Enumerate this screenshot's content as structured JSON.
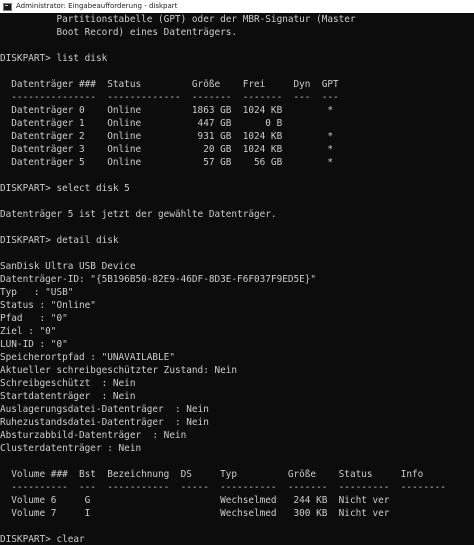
{
  "window": {
    "title": "Administrator: Eingabeaufforderung - diskpart"
  },
  "console": {
    "lines": [
      "          Partitionstabelle (GPT) oder der MBR-Signatur (Master",
      "          Boot Record) eines Datenträgers.",
      "",
      "DISKPART> list disk",
      "",
      "  Datenträger ###  Status         Größe    Frei     Dyn  GPT",
      "  ---------------  -------------  -------  -------  ---  ---",
      "  Datenträger 0    Online         1863 GB  1024 KB        *",
      "  Datenträger 1    Online          447 GB      0 B",
      "  Datenträger 2    Online          931 GB  1024 KB        *",
      "  Datenträger 3    Online           20 GB  1024 KB        *",
      "  Datenträger 5    Online           57 GB    56 GB        *",
      "",
      "DISKPART> select disk 5",
      "",
      "Datenträger 5 ist jetzt der gewählte Datenträger.",
      "",
      "DISKPART> detail disk",
      "",
      "SanDisk Ultra USB Device",
      "Datenträger-ID: \"{5B196B50-82E9-46DF-8D3E-F6F037F9ED5E}\"",
      "Typ   : \"USB\"",
      "Status : \"Online\"",
      "Pfad   : \"0\"",
      "Ziel : \"0\"",
      "LUN-ID : \"0\"",
      "Speicherortpfad : \"UNAVAILABLE\"",
      "Aktueller schreibgeschützter Zustand: Nein",
      "Schreibgeschützt  : Nein",
      "Startdatenträger  : Nein",
      "Auslagerungsdatei-Datenträger  : Nein",
      "Ruhezustandsdatei-Datenträger  : Nein",
      "Absturzabbild-Datenträger  : Nein",
      "Clusterdatenträger : Nein",
      "",
      "  Volume ###  Bst  Bezeichnung  DS     Typ         Größe    Status     Info",
      "  ----------  ---  -----------  -----  ----------  -------  ---------  --------",
      "  Volume 6     G                       Wechselmed   244 KB  Nicht ver",
      "  Volume 7     I                       Wechselmed   300 KB  Nicht ver",
      "",
      "DISKPART> clear"
    ]
  },
  "colors": {
    "background": "#0c0c0c",
    "text": "#cccccc",
    "titlebar": "#ffffff"
  }
}
